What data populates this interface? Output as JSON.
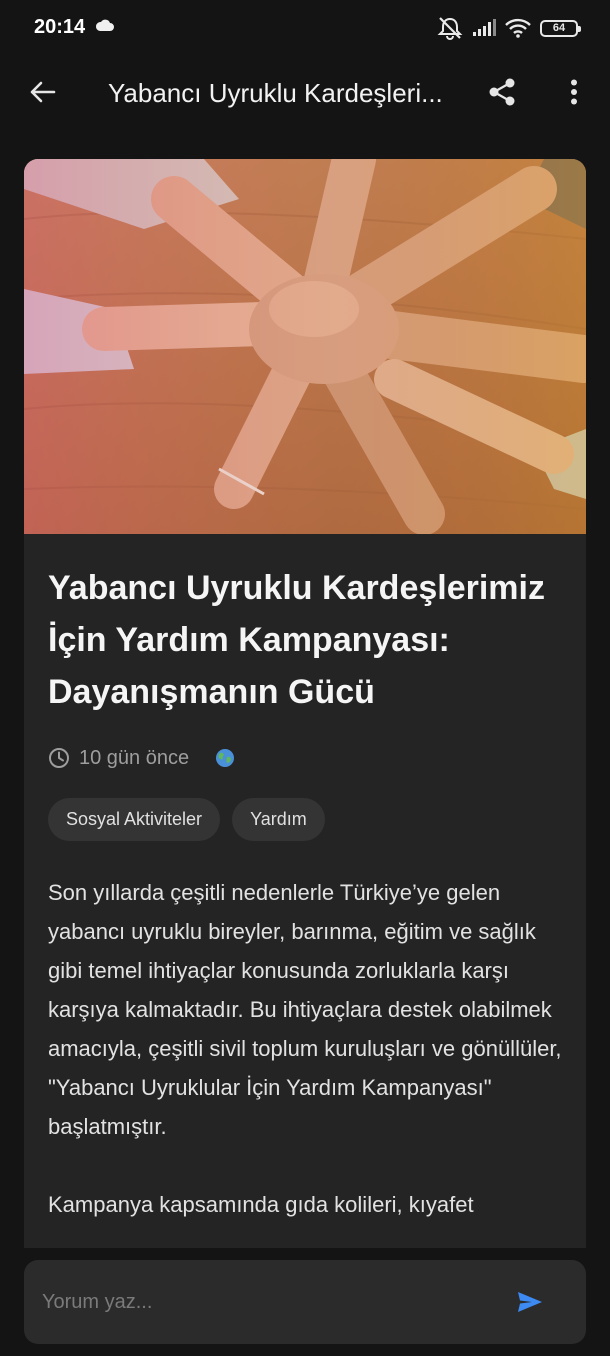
{
  "status_bar": {
    "time": "20:14",
    "battery": "64",
    "icons": [
      "cloud-icon",
      "mute-icon",
      "signal-icon",
      "wifi-icon",
      "battery-icon"
    ]
  },
  "app_bar": {
    "title": "Yabancı Uyruklu Kardeşleri...",
    "icons": [
      "back-arrow-icon",
      "share-icon",
      "more-vert-icon"
    ]
  },
  "article": {
    "title": "Yabancı Uyruklu Kardeşlerimiz İçin Yardım Kampanyası: Dayanışmanın Gücü",
    "time_ago": "10 gün önce",
    "globe": "🌍",
    "tags": [
      "Sosyal Aktiviteler",
      "Yardım"
    ],
    "paragraphs": [
      "Son yıllarda çeşitli nedenlerle Türkiye’ye gelen yabancı uyruklu bireyler, barınma, eğitim ve sağlık gibi temel ihtiyaçlar konusunda zorluklarla karşı karşıya kalmaktadır. Bu ihtiyaçlara destek olabilmek amacıyla, çeşitli sivil toplum kuruluşları ve gönüllüler, \"Yabancı Uyruklular İçin Yardım Kampanyası\" başlatmıştır.",
      "Kampanya kapsamında gıda kolileri, kıyafet"
    ]
  },
  "comment": {
    "placeholder": "Yorum yaz..."
  },
  "colors": {
    "background": "#141414",
    "card": "#242424",
    "tag_bg": "#343434",
    "accent": "#3d8bf2"
  }
}
